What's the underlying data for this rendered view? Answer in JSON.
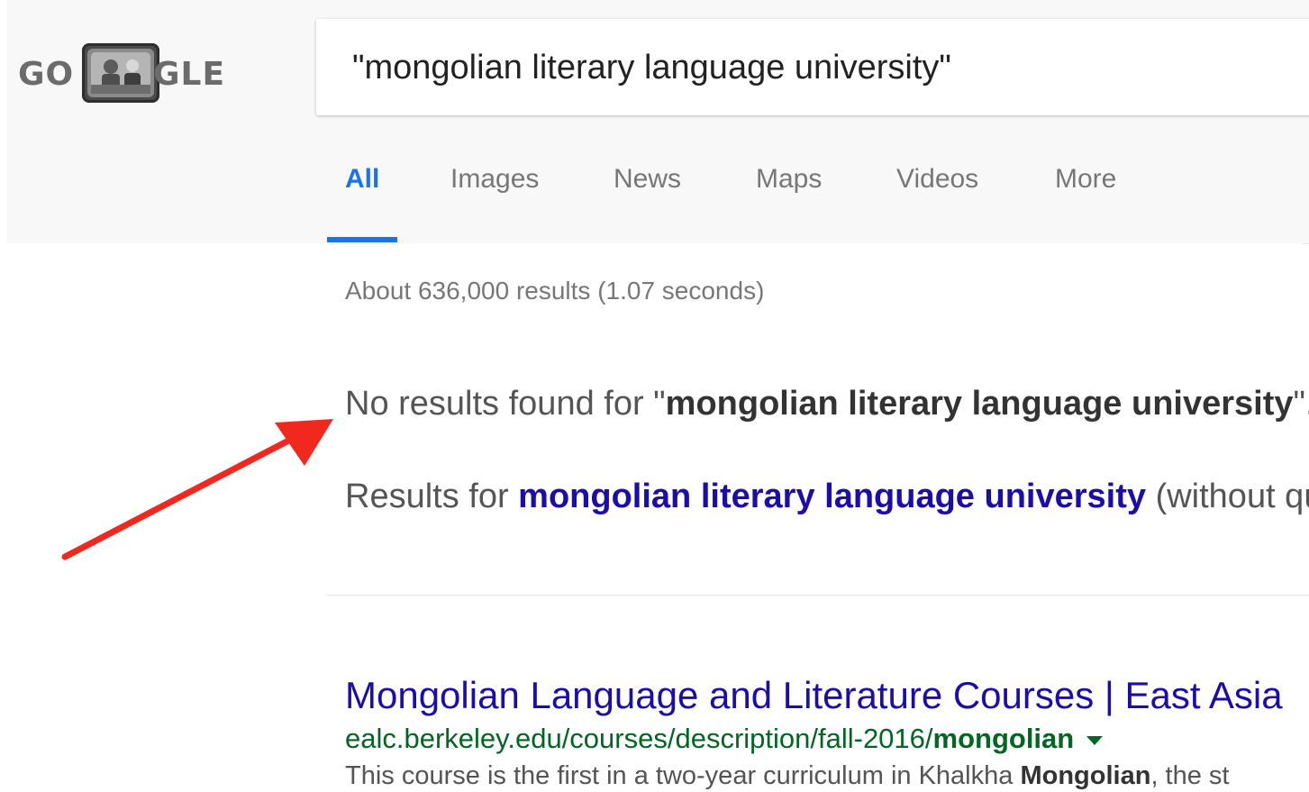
{
  "logo": {
    "left_text": "GO",
    "right_text": "GLE"
  },
  "search": {
    "query": "\"mongolian literary language university\""
  },
  "tabs": [
    {
      "label": "All",
      "active": true
    },
    {
      "label": "Images",
      "active": false
    },
    {
      "label": "News",
      "active": false
    },
    {
      "label": "Maps",
      "active": false
    },
    {
      "label": "Videos",
      "active": false
    },
    {
      "label": "More",
      "active": false
    }
  ],
  "stats": "About 636,000 results (1.07 seconds)",
  "notice": {
    "prefix": "No results found for \"",
    "query": "mongolian literary language university",
    "suffix": "\"."
  },
  "results_for": {
    "prefix": "Results for ",
    "link": "mongolian literary language university",
    "suffix": " (without qu"
  },
  "result": {
    "title": "Mongolian Language and Literature Courses | East Asia",
    "url_prefix": "ealc.berkeley.edu/courses/description/fall-2016/",
    "url_bold": "mongolian",
    "snippet_prefix": "This course is the first in a two-year curriculum in Khalkha ",
    "snippet_bold": "Mongolian",
    "snippet_suffix": ", the st"
  },
  "colors": {
    "accent": "#1a73e8",
    "link": "#1a0dab",
    "url": "#006621",
    "arrow": "#f0281e"
  },
  "icons": {
    "logo_center": "retro-tv-doodle-icon",
    "url_menu": "caret-down-icon",
    "annotation": "red-arrow-icon"
  }
}
